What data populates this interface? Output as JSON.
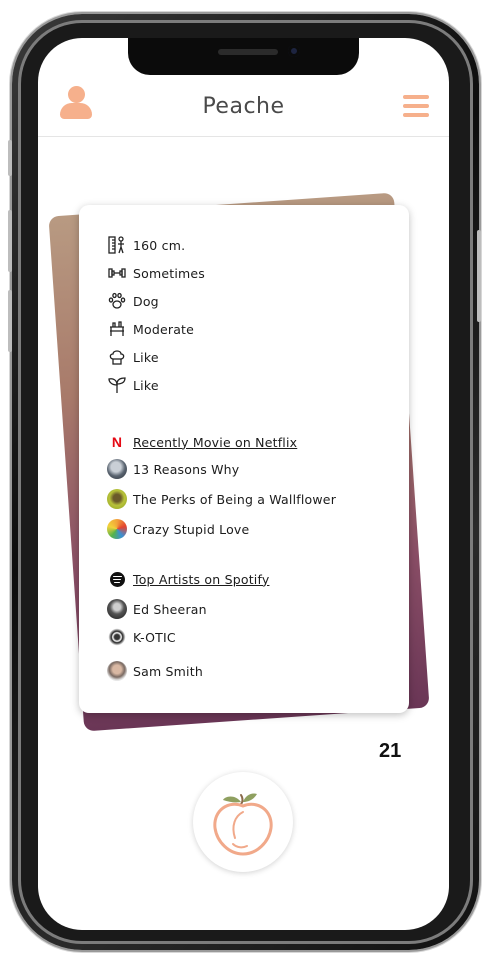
{
  "app": {
    "title": "Peache"
  },
  "profile": {
    "attributes": [
      {
        "icon": "height-icon",
        "label": "160 cm."
      },
      {
        "icon": "dumbbell-icon",
        "label": "Sometimes"
      },
      {
        "icon": "paw-icon",
        "label": "Dog"
      },
      {
        "icon": "drinks-icon",
        "label": "Moderate"
      },
      {
        "icon": "chef-hat-icon",
        "label": "Like"
      },
      {
        "icon": "sprout-icon",
        "label": "Like"
      }
    ],
    "movies": {
      "brand_letter": "N",
      "title": "Recently Movie on Netflix",
      "items": [
        "13 Reasons Why",
        "The Perks of Being a Wallflower",
        "Crazy Stupid Love"
      ]
    },
    "artists": {
      "title": "Top Artists on Spotify",
      "items": [
        "Ed Sheeran",
        "K-OTIC",
        "Sam Smith"
      ]
    },
    "count": "21"
  },
  "colors": {
    "accent": "#f6b08c",
    "netflix": "#e50914"
  }
}
